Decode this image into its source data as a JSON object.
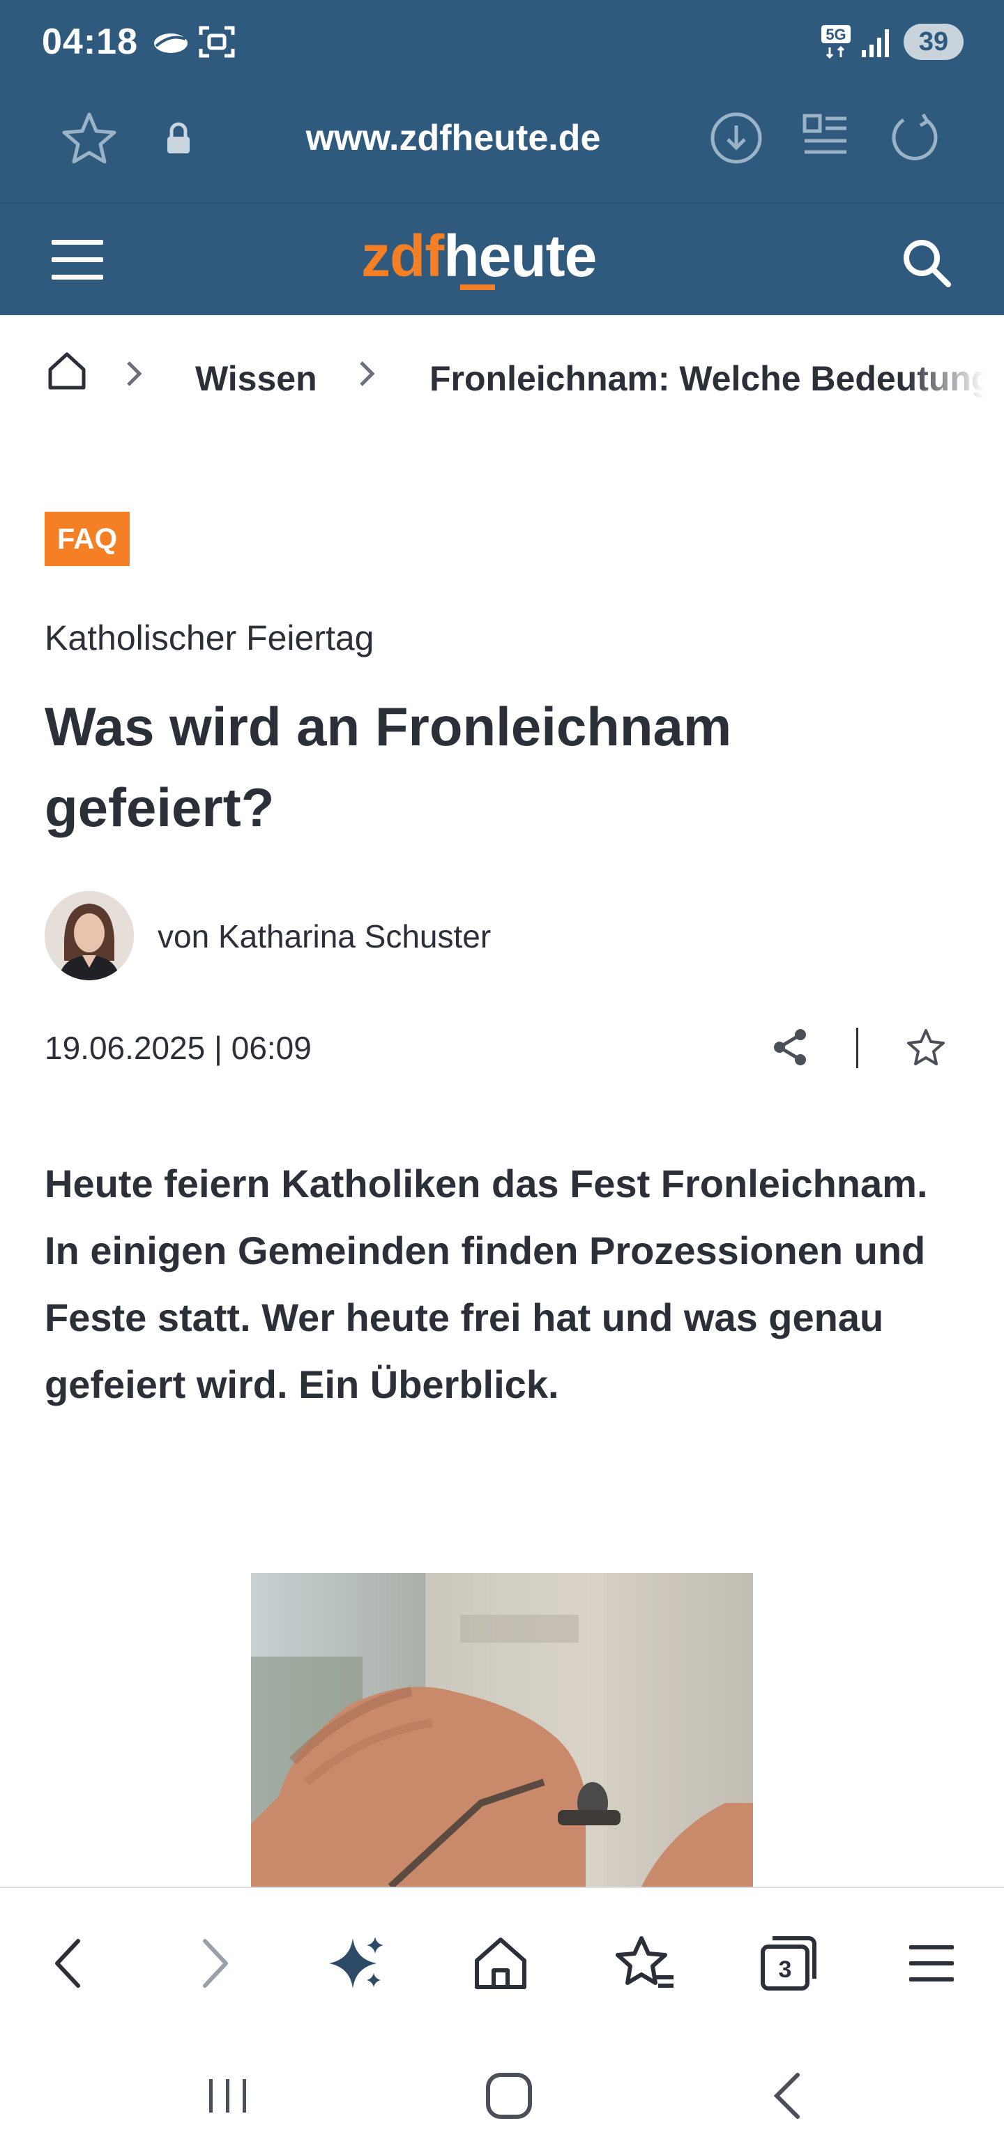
{
  "status_bar": {
    "time": "04:18",
    "network": "5G",
    "battery": "39",
    "icons": [
      "cloud-icon",
      "screenshot-icon",
      "5g-icon",
      "signal-icon",
      "battery-icon"
    ]
  },
  "browser": {
    "url": "www.zdfheute.de",
    "icons": [
      "star-icon",
      "lock-icon",
      "download-icon",
      "reader-mode-icon",
      "reload-icon"
    ]
  },
  "site": {
    "logo_zdf": "zdf",
    "logo_heute": "heute",
    "menu_icon": "menu-icon",
    "search_icon": "search-icon",
    "colors": {
      "header": "#2f5a7e",
      "brand": "#f47f24",
      "text": "#2b2f38"
    }
  },
  "breadcrumb": {
    "home_icon": "home-icon",
    "items": [
      "Wissen",
      "Fronleichnam: Welche Bedeutung"
    ]
  },
  "article": {
    "badge": "FAQ",
    "kicker": "Katholischer Feiertag",
    "headline": "Was wird an Fronleichnam gefeiert?",
    "author": "von Katharina Schuster",
    "date": "19.06.2025 | 06:09",
    "share_icon": "share-icon",
    "bookmark_icon": "star-outline-icon",
    "lead": "Heute feiern Katholiken das Fest Fronleichnam. In einigen Gemeinden finden Prozessionen und Feste statt. Wer heute frei hat und was genau gefeiert wird. Ein Überblick."
  },
  "toolbar": {
    "items": [
      "back-icon",
      "forward-icon",
      "ai-sparkle-icon",
      "home-icon",
      "bookmarks-icon",
      "tabs-icon",
      "menu-icon"
    ],
    "tab_count": "3"
  },
  "system_nav": {
    "items": [
      "recents-icon",
      "home-icon",
      "back-icon"
    ]
  }
}
